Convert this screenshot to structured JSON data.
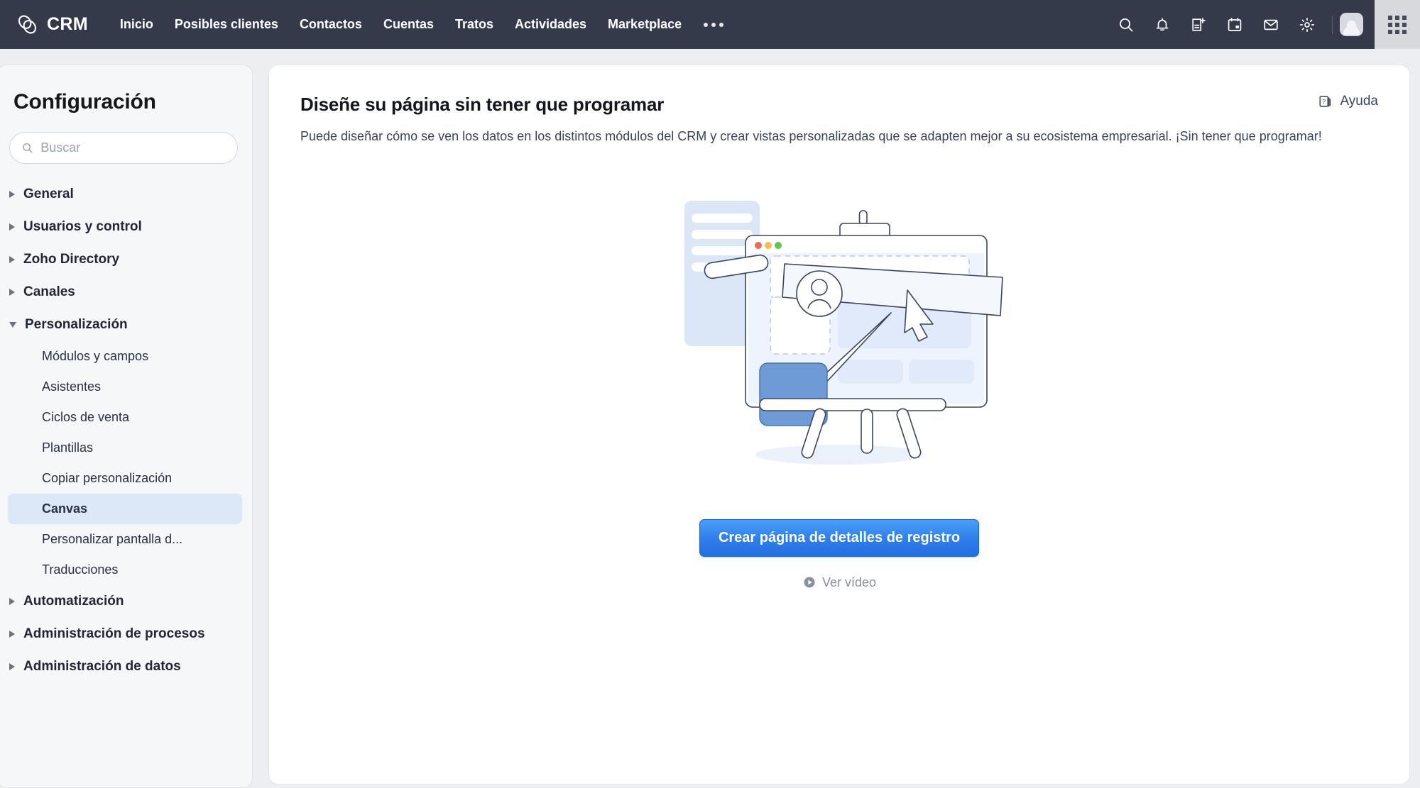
{
  "topbar": {
    "brand": "CRM",
    "logo_icon": "zoho-loop-logo-icon",
    "nav": [
      {
        "label": "Inicio"
      },
      {
        "label": "Posibles clientes"
      },
      {
        "label": "Contactos"
      },
      {
        "label": "Cuentas"
      },
      {
        "label": "Tratos"
      },
      {
        "label": "Actividades"
      },
      {
        "label": "Marketplace"
      }
    ],
    "more_icon": "ellipsis-icon",
    "icons": [
      {
        "name": "search-icon"
      },
      {
        "name": "bell-icon"
      },
      {
        "name": "add-note-icon"
      },
      {
        "name": "calendar-icon"
      },
      {
        "name": "mail-icon"
      },
      {
        "name": "gear-icon"
      }
    ],
    "avatar_icon": "user-avatar",
    "app_switcher_icon": "app-grid-icon",
    "background_color": "#353a4b"
  },
  "sidebar": {
    "title": "Configuración",
    "search": {
      "value": "",
      "placeholder": "Buscar",
      "icon": "search-icon"
    },
    "groups": [
      {
        "label": "General",
        "expanded": false
      },
      {
        "label": "Usuarios y control",
        "expanded": false
      },
      {
        "label": "Zoho Directory",
        "expanded": false
      },
      {
        "label": "Canales",
        "expanded": false
      },
      {
        "label": "Personalización",
        "expanded": true,
        "items": [
          {
            "label": "Módulos y campos",
            "active": false
          },
          {
            "label": "Asistentes",
            "active": false
          },
          {
            "label": "Ciclos de venta",
            "active": false
          },
          {
            "label": "Plantillas",
            "active": false
          },
          {
            "label": "Copiar personalización",
            "active": false
          },
          {
            "label": "Canvas",
            "active": true
          },
          {
            "label": "Personalizar pantalla d...",
            "active": false
          },
          {
            "label": "Traducciones",
            "active": false
          }
        ]
      },
      {
        "label": "Automatización",
        "expanded": false
      },
      {
        "label": "Administración de procesos",
        "expanded": false
      },
      {
        "label": "Administración de datos",
        "expanded": false
      }
    ],
    "active_item": "Canvas",
    "active_color": "#dce7f7"
  },
  "content": {
    "title": "Diseñe su página sin tener que programar",
    "description": "Puede diseñar cómo se ven los datos en los distintos módulos del CRM y crear vistas personalizadas que se adapten mejor a su ecosistema empresarial. ¡Sin tener que programar!",
    "help": {
      "label": "Ayuda",
      "icon": "help-pages-icon"
    },
    "illustration": {
      "name": "canvas-easel-illustration",
      "elements": [
        "back-card",
        "browser-window",
        "avatar-circle",
        "cursor-arrow",
        "paintbrush",
        "blue-swatch",
        "easel-legs"
      ],
      "window_dots": [
        "#ed6a5e",
        "#f4bd4f",
        "#61c554"
      ],
      "accent_color": "#6e9ad6"
    },
    "cta_button": {
      "label": "Crear página de detalles de registro",
      "color": "#2f7ceb"
    },
    "video_link": {
      "label": "Ver vídeo",
      "icon": "play-circle-icon"
    }
  }
}
